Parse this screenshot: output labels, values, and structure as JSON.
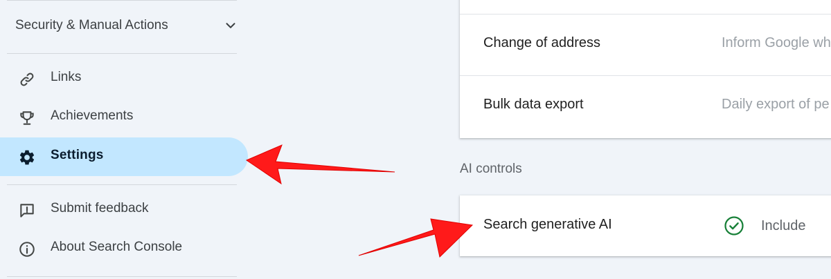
{
  "sidebar": {
    "section": {
      "label": "Security & Manual Actions",
      "icon": "chevron-down-icon"
    },
    "items": [
      {
        "label": "Links",
        "icon": "link-icon"
      },
      {
        "label": "Achievements",
        "icon": "trophy-icon"
      },
      {
        "label": "Settings",
        "icon": "gear-icon",
        "active": true
      },
      {
        "label": "Submit feedback",
        "icon": "feedback-icon"
      },
      {
        "label": "About Search Console",
        "icon": "info-icon"
      }
    ]
  },
  "main": {
    "settings_rows": [
      {
        "label": "Change of address",
        "description": "Inform Google wh"
      },
      {
        "label": "Bulk data export",
        "description": "Daily export of pe"
      }
    ],
    "ai_section": {
      "title": "AI controls",
      "row": {
        "label": "Search generative AI",
        "status": "Include",
        "status_icon": "check-circle-icon"
      }
    }
  },
  "colors": {
    "background": "#f0f4f9",
    "active_nav": "#c2e7ff",
    "check_green": "#188038",
    "annotation_arrow": "#ff1a1a"
  }
}
